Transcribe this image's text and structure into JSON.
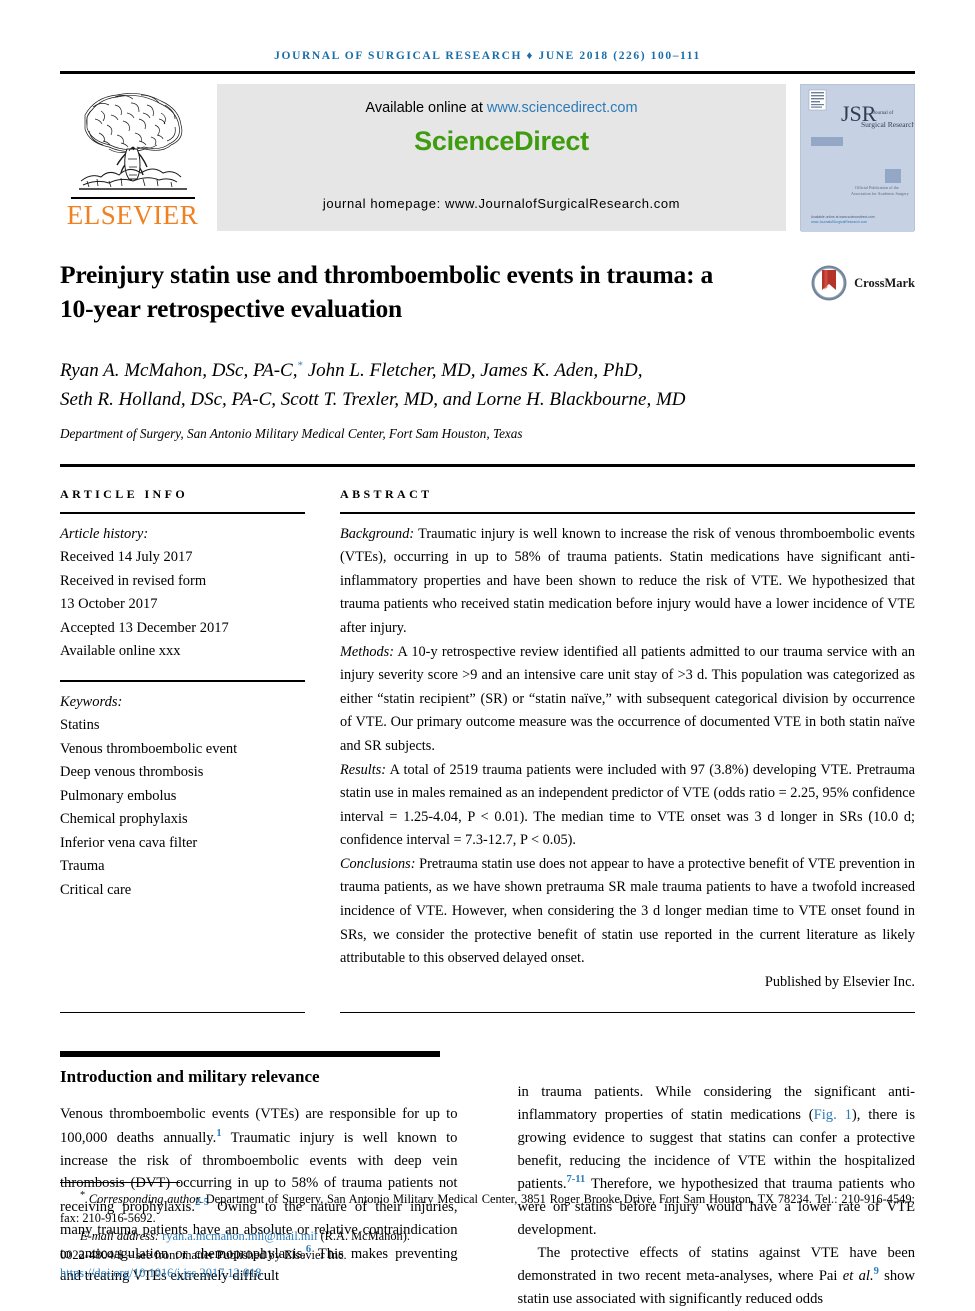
{
  "running_head": "Journal of Surgical Research ♦ June 2018 (226) 100–111",
  "masthead": {
    "publisher_name": "ELSEVIER",
    "available_text": "Available online at",
    "available_url": "www.sciencedirect.com",
    "sciencedirect_logo": "ScienceDirect",
    "journal_homepage": "journal homepage: www.JournalofSurgicalResearch.com",
    "cover": {
      "title_abbrev": "JSR",
      "title_full_line1": "Journal of",
      "title_full_line2": "Surgical Research",
      "tagline_line1": "Official Publication of the",
      "tagline_line2": "Association for Academic Surgery",
      "footer_line1": "Available online at www.sciencedirect.com",
      "footer_line2": "www.JournalofSurgicalResearch.com"
    }
  },
  "article": {
    "title": "Preinjury statin use and thromboembolic events in trauma: a 10-year retrospective evaluation",
    "crossmark_label": "CrossMark",
    "authors_line1": "Ryan A. McMahon, DSc, PA-C,",
    "authors_line1_star": "*",
    "authors_line1_cont": " John L. Fletcher, MD, James K. Aden, PhD,",
    "authors_line2": "Seth R. Holland, DSc, PA-C, Scott T. Trexler, MD, and Lorne H. Blackbourne, MD",
    "affiliation": "Department of Surgery, San Antonio Military Medical Center, Fort Sam Houston, Texas"
  },
  "article_info": {
    "label": "ARTICLE INFO",
    "history_title": "Article history:",
    "history": [
      "Received 14 July 2017",
      "Received in revised form",
      "13 October 2017",
      "Accepted 13 December 2017",
      "Available online xxx"
    ],
    "keywords_title": "Keywords:",
    "keywords": [
      "Statins",
      "Venous thromboembolic event",
      "Deep venous thrombosis",
      "Pulmonary embolus",
      "Chemical prophylaxis",
      "Inferior vena cava filter",
      "Trauma",
      "Critical care"
    ]
  },
  "abstract": {
    "label": "ABSTRACT",
    "background_lead": "Background:",
    "background_text": " Traumatic injury is well known to increase the risk of venous thromboembolic events (VTEs), occurring in up to 58% of trauma patients. Statin medications have significant anti-inflammatory properties and have been shown to reduce the risk of VTE. We hypothesized that trauma patients who received statin medication before injury would have a lower incidence of VTE after injury.",
    "methods_lead": "Methods:",
    "methods_text": " A 10-y retrospective review identified all patients admitted to our trauma service with an injury severity score >9 and an intensive care unit stay of >3 d. This population was categorized as either “statin recipient” (SR) or “statin naïve,” with subsequent categorical division by occurrence of VTE. Our primary outcome measure was the occurrence of documented VTE in both statin naïve and SR subjects.",
    "results_lead": "Results:",
    "results_text": " A total of 2519 trauma patients were included with 97 (3.8%) developing VTE. Pretrauma statin use in males remained as an independent predictor of VTE (odds ratio = 2.25, 95% confidence interval = 1.25-4.04, P < 0.01). The median time to VTE onset was 3 d longer in SRs (10.0 d; confidence interval = 7.3-12.7, P < 0.05).",
    "conclusions_lead": "Conclusions:",
    "conclusions_text": " Pretrauma statin use does not appear to have a protective benefit of VTE prevention in trauma patients, as we have shown pretrauma SR male trauma patients to have a twofold increased incidence of VTE. However, when considering the 3 d longer median time to VTE onset found in SRs, we consider the protective benefit of statin use reported in the current literature as likely attributable to this observed delayed onset.",
    "published_by": "Published by Elsevier Inc."
  },
  "body": {
    "section_heading": "Introduction and military relevance",
    "left_col": {
      "p1_a": "Venous thromboembolic events (VTEs) are responsible for up to 100,000 deaths annually.",
      "p1_ref1": "1",
      "p1_b": " Traumatic injury is well known to increase the risk of thromboembolic events with deep vein thrombosis (DVT) occurring in up to 58% of trauma patients not receiving prophylaxis.",
      "p1_ref2": "2-5",
      "p1_c": " Owing to the nature of their injuries, many trauma patients have an absolute or relative contraindication to anticoagulation or chemoprophylaxis.",
      "p1_ref3": "6",
      "p1_d": " This makes preventing and treating VTEs extremely difficult"
    },
    "right_col": {
      "p1_a": "in trauma patients. While considering the significant anti-inflammatory properties of statin medications (",
      "p1_figlink": "Fig. 1",
      "p1_b": "), there is growing evidence to suggest that statins can confer a protective benefit, reducing the incidence of VTE within the hospitalized patients.",
      "p1_ref1": "7-11",
      "p1_c": " Therefore, we hypothesized that trauma patients who were on statins before injury would have a lower rate of VTE development.",
      "p2_a": "The protective effects of statins against VTE have been demonstrated in two recent meta-analyses, where Pai ",
      "p2_italic": "et al.",
      "p2_ref": "9",
      "p2_b": " show statin use associated with significantly reduced odds"
    }
  },
  "footnotes": {
    "star": "*",
    "corresponding_lead": "Corresponding author.",
    "corresponding_text": " Department of Surgery, San Antonio Military Medical Center, 3851 Roger Brooke Drive, Fort Sam Houston, TX 78234. Tel.: 210-916-4549; fax: 210-916-5692.",
    "email_label": "E-mail address:",
    "email": "ryan.a.mcmahon.mil@mail.mil",
    "email_suffix": " (R.A. McMahon).",
    "issn_line": "0022-4804/$ – see front matter Published by Elsevier Inc.",
    "doi": "https://doi.org/10.1016/j.jss.2017.12.018"
  },
  "colors": {
    "link_blue": "#2b7bb9",
    "sciencedirect_green": "#3f9c0f",
    "elsevier_orange": "#f08020",
    "running_head_blue": "#1a6ea8",
    "crossmark_red": "#b5342a",
    "cover_blue": "#c3d0e3"
  }
}
